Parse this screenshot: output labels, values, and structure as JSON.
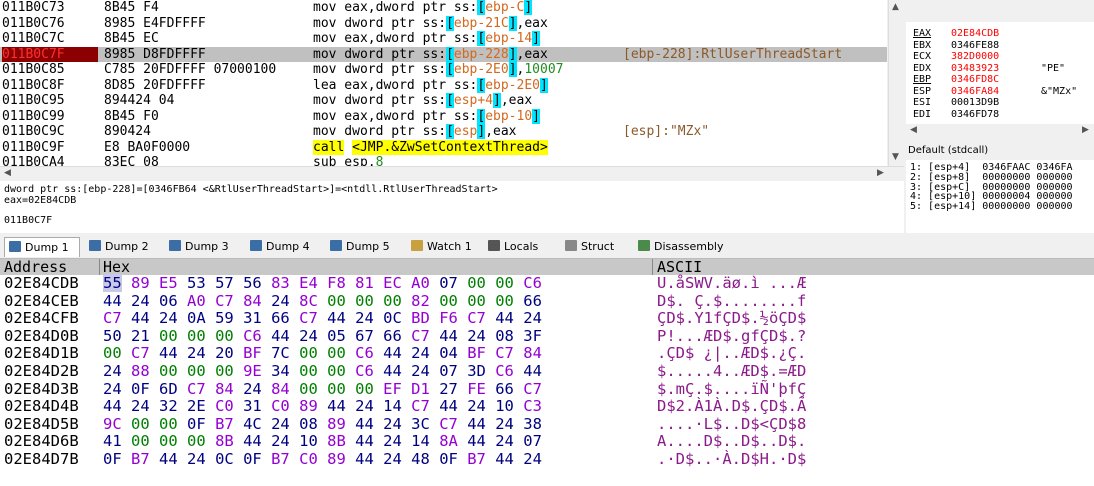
{
  "disasm": {
    "rows": [
      {
        "addr": "011B0C73",
        "bytes": "8B45 F4",
        "seg": [
          [
            "mov eax,dword ptr ss:",
            ""
          ],
          [
            "[",
            "br"
          ],
          [
            "ebp-C",
            "orange"
          ],
          [
            "]",
            "br"
          ]
        ],
        "comment": ""
      },
      {
        "addr": "011B0C76",
        "bytes": "8985 E4FDFFFF",
        "seg": [
          [
            "mov dword ptr ss:",
            ""
          ],
          [
            "[",
            "br"
          ],
          [
            "ebp-21C",
            "orange"
          ],
          [
            "]",
            "br"
          ],
          [
            ",eax",
            ""
          ]
        ],
        "comment": ""
      },
      {
        "addr": "011B0C7C",
        "bytes": "8B45 EC",
        "seg": [
          [
            "mov eax,dword ptr ss:",
            ""
          ],
          [
            "[",
            "br"
          ],
          [
            "ebp-14",
            "orange"
          ],
          [
            "]",
            "br"
          ]
        ],
        "comment": ""
      },
      {
        "addr": "011B0C7F",
        "bytes": "8985 D8FDFFFF",
        "seg": [
          [
            "mov dword ptr ss:",
            ""
          ],
          [
            "[",
            "br"
          ],
          [
            "ebp-228",
            "orange"
          ],
          [
            "]",
            "br"
          ],
          [
            ",eax",
            ""
          ]
        ],
        "comment": "[ebp-228]:RtlUserThreadStart",
        "selected": true
      },
      {
        "addr": "011B0C85",
        "bytes": "C785 20FDFFFF 07000100",
        "seg": [
          [
            "mov dword ptr ss:",
            ""
          ],
          [
            "[",
            "br"
          ],
          [
            "ebp-2E0",
            "orange"
          ],
          [
            "]",
            "br"
          ],
          [
            ",",
            ""
          ],
          [
            "10007",
            "num"
          ]
        ],
        "comment": ""
      },
      {
        "addr": "011B0C8F",
        "bytes": "8D85 20FDFFFF",
        "seg": [
          [
            "lea eax,dword ptr ss:",
            ""
          ],
          [
            "[",
            "br"
          ],
          [
            "ebp-2E0",
            "orange"
          ],
          [
            "]",
            "br"
          ]
        ],
        "comment": ""
      },
      {
        "addr": "011B0C95",
        "bytes": "894424 04",
        "seg": [
          [
            "mov dword ptr ss:",
            ""
          ],
          [
            "[",
            "br"
          ],
          [
            "esp+4",
            "orange"
          ],
          [
            "]",
            "br"
          ],
          [
            ",eax",
            ""
          ]
        ],
        "comment": ""
      },
      {
        "addr": "011B0C99",
        "bytes": "8B45 F0",
        "seg": [
          [
            "mov eax,dword ptr ss:",
            ""
          ],
          [
            "[",
            "br"
          ],
          [
            "ebp-10",
            "orange"
          ],
          [
            "]",
            "br"
          ]
        ],
        "comment": ""
      },
      {
        "addr": "011B0C9C",
        "bytes": "890424",
        "seg": [
          [
            "mov dword ptr ss:",
            ""
          ],
          [
            "[",
            "br"
          ],
          [
            "esp",
            "orange"
          ],
          [
            "]",
            "br"
          ],
          [
            ",eax",
            ""
          ]
        ],
        "comment": "[esp]:\"MZx\""
      },
      {
        "addr": "011B0C9F",
        "bytes": "E8 BA0F0000",
        "seg": [
          [
            "call",
            "callkw"
          ],
          [
            " ",
            ""
          ],
          [
            "<JMP.&ZwSetContextThread>",
            "calltg"
          ]
        ],
        "comment": ""
      },
      {
        "addr": "011B0CA4",
        "bytes": "83EC 08",
        "seg": [
          [
            "sub esp,",
            ""
          ],
          [
            "8",
            "num"
          ]
        ],
        "comment": ""
      }
    ]
  },
  "info": {
    "line1": "dword ptr ss:[ebp-228]=[0346FB64 <&RtlUserThreadStart>]=<ntdll.RtlUserThreadStart>",
    "line2": "eax=02E84CDB",
    "line3": "011B0C7F"
  },
  "registers": [
    {
      "name": "EAX",
      "value": "02E84CDB",
      "comment": "",
      "changed": true,
      "underline": true
    },
    {
      "name": "EBX",
      "value": "0346FE88",
      "comment": ""
    },
    {
      "name": "ECX",
      "value": "382D0000",
      "comment": "",
      "changed": true
    },
    {
      "name": "EDX",
      "value": "03483923",
      "comment": "\"PE\"",
      "changed": true
    },
    {
      "name": "EBP",
      "value": "0346FD8C",
      "comment": "",
      "changed": true,
      "underline": true
    },
    {
      "name": "ESP",
      "value": "0346FA84",
      "comment": "&\"MZx\"",
      "changed": true
    },
    {
      "name": "ESI",
      "value": "00013D9B",
      "comment": ""
    },
    {
      "name": "EDI",
      "value": "0346FD78",
      "comment": ""
    }
  ],
  "callstack": {
    "title": "Default (stdcall)",
    "rows": [
      "1: [esp+4]  0346FAAC 0346FA",
      "2: [esp+8]  00000000 000000",
      "3: [esp+C]  00000000 000000",
      "4: [esp+10] 00000004 000000",
      "5: [esp+14] 00000000 000000"
    ]
  },
  "tabs": [
    {
      "label": "Dump 1",
      "icon": "dump-icon",
      "active": true
    },
    {
      "label": "Dump 2",
      "icon": "dump-icon"
    },
    {
      "label": "Dump 3",
      "icon": "dump-icon"
    },
    {
      "label": "Dump 4",
      "icon": "dump-icon"
    },
    {
      "label": "Dump 5",
      "icon": "dump-icon"
    },
    {
      "label": "Watch 1",
      "icon": "watch-icon"
    },
    {
      "label": "Locals",
      "icon": "locals-icon"
    },
    {
      "label": "Struct",
      "icon": "struct-icon"
    },
    {
      "label": "Disassembly",
      "icon": "disassembly-icon"
    }
  ],
  "dump": {
    "headers": {
      "address": "Address",
      "hex": "Hex",
      "ascii": "ASCII"
    },
    "rows": [
      {
        "addr": "02E84CDB",
        "bytes": [
          "55",
          "89",
          "E5",
          "53",
          "57",
          "56",
          "83",
          "E4",
          "F8",
          "81",
          "EC",
          "A0",
          "07",
          "00",
          "00",
          "C6"
        ],
        "ascii": "U.åSWV.äø.ì ...Æ",
        "sel": 0
      },
      {
        "addr": "02E84CEB",
        "bytes": [
          "44",
          "24",
          "06",
          "A0",
          "C7",
          "84",
          "24",
          "8C",
          "00",
          "00",
          "00",
          "82",
          "00",
          "00",
          "00",
          "66"
        ],
        "ascii": "D$. Ç.$........f"
      },
      {
        "addr": "02E84CFB",
        "bytes": [
          "C7",
          "44",
          "24",
          "0A",
          "59",
          "31",
          "66",
          "C7",
          "44",
          "24",
          "0C",
          "BD",
          "F6",
          "C7",
          "44",
          "24"
        ],
        "ascii": "ÇD$.Y1fÇD$.½öÇD$"
      },
      {
        "addr": "02E84D0B",
        "bytes": [
          "50",
          "21",
          "00",
          "00",
          "00",
          "C6",
          "44",
          "24",
          "05",
          "67",
          "66",
          "C7",
          "44",
          "24",
          "08",
          "3F"
        ],
        "ascii": "P!...ÆD$.gfÇD$.?"
      },
      {
        "addr": "02E84D1B",
        "bytes": [
          "00",
          "C7",
          "44",
          "24",
          "20",
          "BF",
          "7C",
          "00",
          "00",
          "C6",
          "44",
          "24",
          "04",
          "BF",
          "C7",
          "84"
        ],
        "ascii": ".ÇD$ ¿|..ÆD$.¿Ç."
      },
      {
        "addr": "02E84D2B",
        "bytes": [
          "24",
          "88",
          "00",
          "00",
          "00",
          "9E",
          "34",
          "00",
          "00",
          "C6",
          "44",
          "24",
          "07",
          "3D",
          "C6",
          "44"
        ],
        "ascii": "$.....4..ÆD$.=ÆD"
      },
      {
        "addr": "02E84D3B",
        "bytes": [
          "24",
          "0F",
          "6D",
          "C7",
          "84",
          "24",
          "84",
          "00",
          "00",
          "00",
          "EF",
          "D1",
          "27",
          "FE",
          "66",
          "C7"
        ],
        "ascii": "$.mÇ.$....ïÑ'þfÇ"
      },
      {
        "addr": "02E84D4B",
        "bytes": [
          "44",
          "24",
          "32",
          "2E",
          "C0",
          "31",
          "C0",
          "89",
          "44",
          "24",
          "14",
          "C7",
          "44",
          "24",
          "10",
          "C3"
        ],
        "ascii": "D$2.À1À.D$.ÇD$.Ã"
      },
      {
        "addr": "02E84D5B",
        "bytes": [
          "9C",
          "00",
          "00",
          "0F",
          "B7",
          "4C",
          "24",
          "08",
          "89",
          "44",
          "24",
          "3C",
          "C7",
          "44",
          "24",
          "38"
        ],
        "ascii": "....·L$..D$<ÇD$8"
      },
      {
        "addr": "02E84D6B",
        "bytes": [
          "41",
          "00",
          "00",
          "00",
          "8B",
          "44",
          "24",
          "10",
          "8B",
          "44",
          "24",
          "14",
          "8A",
          "44",
          "24",
          "07"
        ],
        "ascii": "A....D$..D$..D$."
      },
      {
        "addr": "02E84D7B",
        "bytes": [
          "0F",
          "B7",
          "44",
          "24",
          "0C",
          "0F",
          "B7",
          "C0",
          "89",
          "44",
          "24",
          "48",
          "0F",
          "B7",
          "44",
          "24"
        ],
        "ascii": ".·D$..·À.D$H.·D$"
      }
    ]
  },
  "colors": {
    "selected_addr_bg": "#8b0000",
    "bracket_bg": "#00e5ff",
    "call_bg": "#ffff00",
    "reg_changed": "#ff0000",
    "zero_byte": "#008000",
    "high_byte": "#9400d3",
    "ascii": "#8b1a8b"
  }
}
